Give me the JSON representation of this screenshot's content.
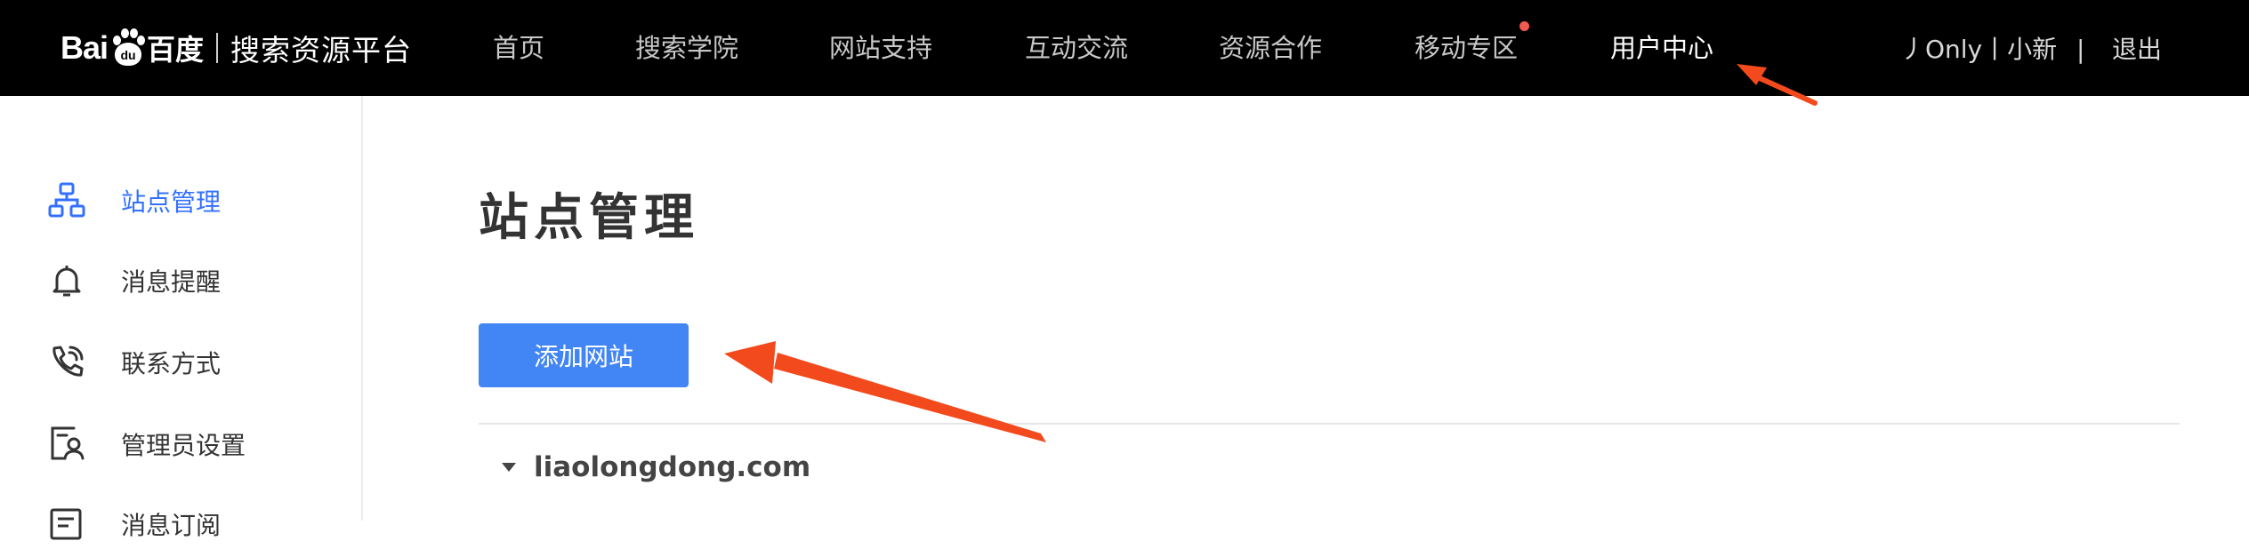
{
  "topbar": {
    "logo": {
      "bai": "Bai",
      "paw_du": "du",
      "baidu_cn": "百度",
      "product": "搜索资源平台"
    },
    "nav": [
      {
        "label": "首页"
      },
      {
        "label": "搜索学院"
      },
      {
        "label": "网站支持"
      },
      {
        "label": "互动交流"
      },
      {
        "label": "资源合作"
      },
      {
        "label": "移动专区"
      },
      {
        "label": "用户中心"
      }
    ],
    "user": {
      "name": "丿Only丨小新",
      "separator": "|",
      "logout": "退出"
    }
  },
  "sidebar": {
    "items": [
      {
        "label": "站点管理",
        "icon": "sitemap-icon"
      },
      {
        "label": "消息提醒",
        "icon": "bell-icon"
      },
      {
        "label": "联系方式",
        "icon": "phone-icon"
      },
      {
        "label": "管理员设置",
        "icon": "admin-profile-icon"
      },
      {
        "label": "消息订阅",
        "icon": "subscribe-icon"
      }
    ]
  },
  "main": {
    "title": "站点管理",
    "add_button": "添加网站",
    "sites": [
      {
        "domain": "liaolongdong.com"
      }
    ]
  },
  "colors": {
    "topbar_bg": "#000000",
    "accent": "#3370ff",
    "button": "#4285f4",
    "annotation_arrow": "#f24a1c",
    "notify_dot": "#f05a4f"
  }
}
